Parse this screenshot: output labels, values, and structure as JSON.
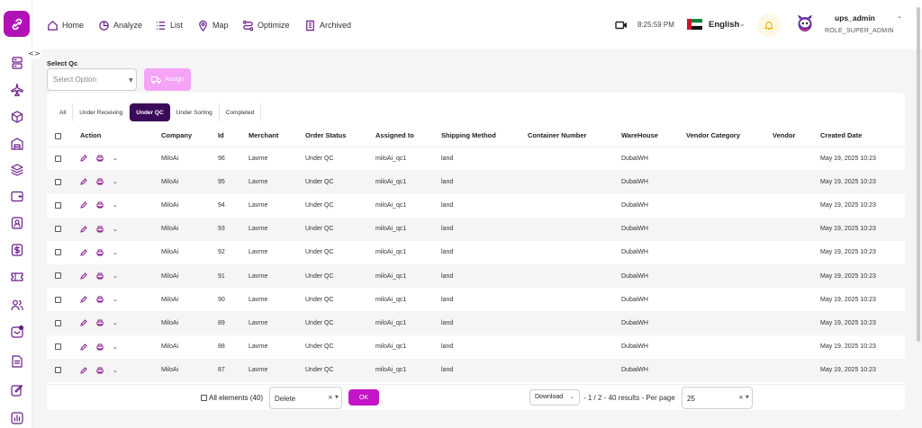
{
  "colors": {
    "brand": "#b012b8",
    "active_tab": "#3b0a59",
    "assign": "#f4a3f6",
    "ok": "#c414c8"
  },
  "sidebar": {
    "logo_icon": "link-icon",
    "toggle": "<>",
    "items": [
      "server-icon",
      "plane-icon",
      "box-icon",
      "warehouse-icon",
      "layers-icon",
      "wallet-icon",
      "user-badge-icon",
      "dollar-icon",
      "ticket-icon",
      "users-icon",
      "message-icon",
      "document-icon",
      "edit-icon",
      "chart-icon"
    ]
  },
  "nav": {
    "items": [
      {
        "label": "Home",
        "icon": "home-icon"
      },
      {
        "label": "Analyze",
        "icon": "pie-chart-icon"
      },
      {
        "label": "List",
        "icon": "list-icon"
      },
      {
        "label": "Map",
        "icon": "map-pin-icon"
      },
      {
        "label": "Optimize",
        "icon": "route-icon"
      },
      {
        "label": "Archived",
        "icon": "archive-icon"
      }
    ],
    "time": "8:25:59 PM",
    "language": "English",
    "user_name": "ups_admin",
    "user_role": "ROLE_SUPER_ADMIN"
  },
  "filter": {
    "label": "Select Qc",
    "placeholder": "Select Option",
    "assign_label": "Assign"
  },
  "tabs": [
    {
      "label": "All",
      "active": false
    },
    {
      "label": "Under Receiving",
      "active": false
    },
    {
      "label": "Under QC",
      "active": true
    },
    {
      "label": "Under Sorting",
      "active": false
    },
    {
      "label": "Completed",
      "active": false
    }
  ],
  "table": {
    "headers": [
      "Action",
      "Company",
      "Id",
      "Merchant",
      "Order Status",
      "Assigned to",
      "Shipping Method",
      "Container Number",
      "WareHouse",
      "Vendor Category",
      "Vendor",
      "Created Date"
    ],
    "rows": [
      {
        "company": "MiloAi",
        "id": "96",
        "merchant": "Lavrne",
        "status": "Under QC",
        "assigned": "miloAi_qc1",
        "shipping": "land",
        "container": "",
        "warehouse": "DubaiWH",
        "vendor_category": "",
        "vendor": "",
        "created": "May 19, 2025 10:23"
      },
      {
        "company": "MiloAi",
        "id": "95",
        "merchant": "Lavrne",
        "status": "Under QC",
        "assigned": "miloAi_qc1",
        "shipping": "land",
        "container": "",
        "warehouse": "DubaiWH",
        "vendor_category": "",
        "vendor": "",
        "created": "May 19, 2025 10:23"
      },
      {
        "company": "MiloAi",
        "id": "94",
        "merchant": "Lavrne",
        "status": "Under QC",
        "assigned": "miloAi_qc1",
        "shipping": "land",
        "container": "",
        "warehouse": "DubaiWH",
        "vendor_category": "",
        "vendor": "",
        "created": "May 19, 2025 10:23"
      },
      {
        "company": "MiloAi",
        "id": "93",
        "merchant": "Lavrne",
        "status": "Under QC",
        "assigned": "miloAi_qc1",
        "shipping": "land",
        "container": "",
        "warehouse": "DubaiWH",
        "vendor_category": "",
        "vendor": "",
        "created": "May 19, 2025 10:23"
      },
      {
        "company": "MiloAi",
        "id": "92",
        "merchant": "Lavrne",
        "status": "Under QC",
        "assigned": "miloAi_qc1",
        "shipping": "land",
        "container": "",
        "warehouse": "DubaiWH",
        "vendor_category": "",
        "vendor": "",
        "created": "May 19, 2025 10:23"
      },
      {
        "company": "MiloAi",
        "id": "91",
        "merchant": "Lavrne",
        "status": "Under QC",
        "assigned": "miloAi_qc1",
        "shipping": "land",
        "container": "",
        "warehouse": "DubaiWH",
        "vendor_category": "",
        "vendor": "",
        "created": "May 19, 2025 10:23"
      },
      {
        "company": "MiloAi",
        "id": "90",
        "merchant": "Lavrne",
        "status": "Under QC",
        "assigned": "miloAi_qc1",
        "shipping": "land",
        "container": "",
        "warehouse": "DubaiWH",
        "vendor_category": "",
        "vendor": "",
        "created": "May 19, 2025 10:23"
      },
      {
        "company": "MiloAi",
        "id": "89",
        "merchant": "Lavrne",
        "status": "Under QC",
        "assigned": "miloAi_qc1",
        "shipping": "land",
        "container": "",
        "warehouse": "DubaiWH",
        "vendor_category": "",
        "vendor": "",
        "created": "May 19, 2025 10:23"
      },
      {
        "company": "MiloAi",
        "id": "88",
        "merchant": "Lavrne",
        "status": "Under QC",
        "assigned": "miloAi_qc1",
        "shipping": "land",
        "container": "",
        "warehouse": "DubaiWH",
        "vendor_category": "",
        "vendor": "",
        "created": "May 19, 2025 10:23"
      },
      {
        "company": "MiloAi",
        "id": "87",
        "merchant": "Lavrne",
        "status": "Under QC",
        "assigned": "miloAi_qc1",
        "shipping": "land",
        "container": "",
        "warehouse": "DubaiWH",
        "vendor_category": "",
        "vendor": "",
        "created": "May 19, 2025 10:23"
      }
    ]
  },
  "footer": {
    "all_elements": "All elements (40)",
    "bulk_action": "Delete",
    "ok_label": "OK",
    "download_label": "Download",
    "pagination": "- 1 / 2 - 40 results - Per page",
    "per_page": "25"
  }
}
